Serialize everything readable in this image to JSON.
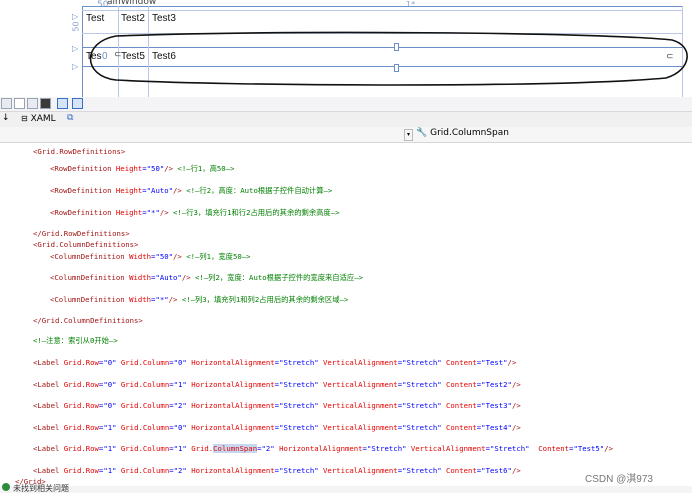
{
  "designer": {
    "window_title_partial": "ainWindow",
    "row_height_marker": "50",
    "col_width_marker": "50",
    "star_marker": "1*",
    "row_cells": [
      "Test",
      "Test2",
      "Test3"
    ],
    "row2_cells": [
      "Tes",
      "0",
      "Test5",
      "Test6"
    ]
  },
  "tabs": {
    "xaml_label": "XAML"
  },
  "breadcrumb": {
    "current": "Grid.ColumnSpan"
  },
  "code_lines": [
    [
      {
        "t": "<Grid.RowDefinitions>",
        "c": "brown"
      }
    ],
    [
      {
        "t": "<RowDefinition ",
        "c": "brown"
      },
      {
        "t": "Height",
        "c": "red"
      },
      {
        "t": "=\"50\"",
        "c": "blue"
      },
      {
        "t": "/> ",
        "c": "brown"
      },
      {
        "t": "<!—行1，高50—>",
        "c": "green"
      }
    ],
    [
      {
        "t": "<RowDefinition ",
        "c": "brown"
      },
      {
        "t": "Height",
        "c": "red"
      },
      {
        "t": "=\"Auto\"",
        "c": "blue"
      },
      {
        "t": "/> ",
        "c": "brown"
      },
      {
        "t": "<!—行2，高度：Auto根据子控件自动计算—>",
        "c": "green"
      }
    ],
    [
      {
        "t": "<RowDefinition ",
        "c": "brown"
      },
      {
        "t": "Height",
        "c": "red"
      },
      {
        "t": "=\"*\"",
        "c": "blue"
      },
      {
        "t": "/> ",
        "c": "brown"
      },
      {
        "t": "<!—行3，填充行1和行2占用后的其余的剩余高度—>",
        "c": "green"
      }
    ],
    [
      {
        "t": "</Grid.RowDefinitions>",
        "c": "brown"
      }
    ],
    [
      {
        "t": "<Grid.ColumnDefinitions>",
        "c": "brown"
      }
    ],
    [
      {
        "t": "<ColumnDefinition ",
        "c": "brown"
      },
      {
        "t": "Width",
        "c": "red"
      },
      {
        "t": "=\"50\"",
        "c": "blue"
      },
      {
        "t": "/> ",
        "c": "brown"
      },
      {
        "t": "<!—列1，宽度50—>",
        "c": "green"
      }
    ],
    [
      {
        "t": "<ColumnDefinition ",
        "c": "brown"
      },
      {
        "t": "Width",
        "c": "red"
      },
      {
        "t": "=\"Auto\"",
        "c": "blue"
      },
      {
        "t": "/> ",
        "c": "brown"
      },
      {
        "t": "<!—列2，宽度：Auto根据子控件的宽度来自适应—>",
        "c": "green"
      }
    ],
    [
      {
        "t": "<ColumnDefinition ",
        "c": "brown"
      },
      {
        "t": "Width",
        "c": "red"
      },
      {
        "t": "=\"*\"",
        "c": "blue"
      },
      {
        "t": "/> ",
        "c": "brown"
      },
      {
        "t": "<!—列3，填充列1和列2占用后的其余的剩余区域—>",
        "c": "green"
      }
    ],
    [
      {
        "t": "</Grid.ColumnDefinitions>",
        "c": "brown"
      }
    ],
    [
      {
        "t": "<!—注意：索引从0开始—>",
        "c": "green"
      }
    ],
    [
      {
        "t": "<Label ",
        "c": "brown"
      },
      {
        "t": "Grid.Row",
        "c": "red"
      },
      {
        "t": "=\"0\" ",
        "c": "blue"
      },
      {
        "t": "Grid.Column",
        "c": "red"
      },
      {
        "t": "=\"0\" ",
        "c": "blue"
      },
      {
        "t": "HorizontalAlignment",
        "c": "red"
      },
      {
        "t": "=\"Stretch\" ",
        "c": "blue"
      },
      {
        "t": "VerticalAlignment",
        "c": "red"
      },
      {
        "t": "=\"Stretch\" ",
        "c": "blue"
      },
      {
        "t": "Content",
        "c": "red"
      },
      {
        "t": "=\"Test\"",
        "c": "blue"
      },
      {
        "t": "/>",
        "c": "brown"
      }
    ],
    [
      {
        "t": "<Label ",
        "c": "brown"
      },
      {
        "t": "Grid.Row",
        "c": "red"
      },
      {
        "t": "=\"0\" ",
        "c": "blue"
      },
      {
        "t": "Grid.Column",
        "c": "red"
      },
      {
        "t": "=\"1\" ",
        "c": "blue"
      },
      {
        "t": "HorizontalAlignment",
        "c": "red"
      },
      {
        "t": "=\"Stretch\" ",
        "c": "blue"
      },
      {
        "t": "VerticalAlignment",
        "c": "red"
      },
      {
        "t": "=\"Stretch\" ",
        "c": "blue"
      },
      {
        "t": "Content",
        "c": "red"
      },
      {
        "t": "=\"Test2\"",
        "c": "blue"
      },
      {
        "t": "/>",
        "c": "brown"
      }
    ],
    [
      {
        "t": "<Label ",
        "c": "brown"
      },
      {
        "t": "Grid.Row",
        "c": "red"
      },
      {
        "t": "=\"0\" ",
        "c": "blue"
      },
      {
        "t": "Grid.Column",
        "c": "red"
      },
      {
        "t": "=\"2\" ",
        "c": "blue"
      },
      {
        "t": "HorizontalAlignment",
        "c": "red"
      },
      {
        "t": "=\"Stretch\" ",
        "c": "blue"
      },
      {
        "t": "VerticalAlignment",
        "c": "red"
      },
      {
        "t": "=\"Stretch\" ",
        "c": "blue"
      },
      {
        "t": "Content",
        "c": "red"
      },
      {
        "t": "=\"Test3\"",
        "c": "blue"
      },
      {
        "t": "/>",
        "c": "brown"
      }
    ],
    [
      {
        "t": "<Label ",
        "c": "brown"
      },
      {
        "t": "Grid.Row",
        "c": "red"
      },
      {
        "t": "=\"1\" ",
        "c": "blue"
      },
      {
        "t": "Grid.Column",
        "c": "red"
      },
      {
        "t": "=\"0\" ",
        "c": "blue"
      },
      {
        "t": "HorizontalAlignment",
        "c": "red"
      },
      {
        "t": "=\"Stretch\" ",
        "c": "blue"
      },
      {
        "t": "VerticalAlignment",
        "c": "red"
      },
      {
        "t": "=\"Stretch\" ",
        "c": "blue"
      },
      {
        "t": "Content",
        "c": "red"
      },
      {
        "t": "=\"Test4\"",
        "c": "blue"
      },
      {
        "t": "/>",
        "c": "brown"
      }
    ],
    [
      {
        "t": "<Label ",
        "c": "brown"
      },
      {
        "t": "Grid.Row",
        "c": "red"
      },
      {
        "t": "=\"1\" ",
        "c": "blue"
      },
      {
        "t": "Grid.Column",
        "c": "red"
      },
      {
        "t": "=\"1\" ",
        "c": "blue"
      },
      {
        "t": "Grid.",
        "c": "red"
      },
      {
        "t": "ColumnSpan",
        "c": "red",
        "hl": true
      },
      {
        "t": "=\"2\" ",
        "c": "blue"
      },
      {
        "t": "HorizontalAlignment",
        "c": "red"
      },
      {
        "t": "=\"Stretch\" ",
        "c": "blue"
      },
      {
        "t": "VerticalAlignment",
        "c": "red"
      },
      {
        "t": "=\"Stretch\"  ",
        "c": "blue"
      },
      {
        "t": "Content",
        "c": "red"
      },
      {
        "t": "=\"Test5\"",
        "c": "blue"
      },
      {
        "t": "/>",
        "c": "brown"
      }
    ],
    [
      {
        "t": "<Label ",
        "c": "brown"
      },
      {
        "t": "Grid.Row",
        "c": "red"
      },
      {
        "t": "=\"1\" ",
        "c": "blue"
      },
      {
        "t": "Grid.Column",
        "c": "red"
      },
      {
        "t": "=\"2\" ",
        "c": "blue"
      },
      {
        "t": "HorizontalAlignment",
        "c": "red"
      },
      {
        "t": "=\"Stretch\" ",
        "c": "blue"
      },
      {
        "t": "VerticalAlignment",
        "c": "red"
      },
      {
        "t": "=\"Stretch\" ",
        "c": "blue"
      },
      {
        "t": "Content",
        "c": "red"
      },
      {
        "t": "=\"Test6\"",
        "c": "blue"
      },
      {
        "t": "/>",
        "c": "brown"
      }
    ],
    [
      {
        "t": "</Grid>",
        "c": "brown"
      }
    ]
  ],
  "status": {
    "message": "未找到相关问题"
  },
  "watermark": "CSDN @淇973"
}
